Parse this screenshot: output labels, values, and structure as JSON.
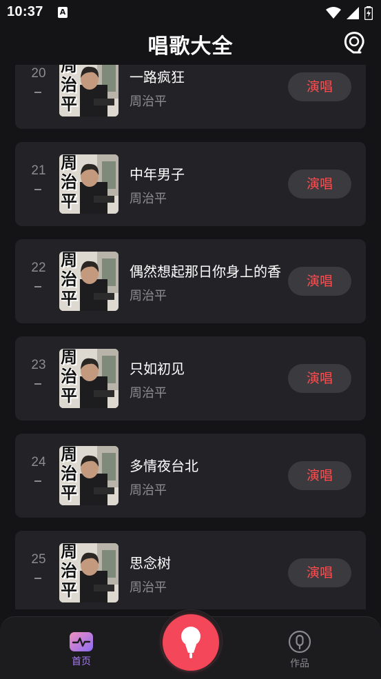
{
  "status_bar": {
    "time": "10:37",
    "app_icon_letter": "A"
  },
  "header": {
    "title": "唱歌大全"
  },
  "colors": {
    "accent_red": "#ff4d4f",
    "fab_red": "#f4475a",
    "nav_active_purple": "#a77cf3",
    "card_bg": "#232327",
    "page_bg": "#141417"
  },
  "cover_text": "周\n治\n平",
  "songs": [
    {
      "rank": "20",
      "title": "一路疯狂",
      "artist": "周治平",
      "button": "演唱"
    },
    {
      "rank": "21",
      "title": "中年男子",
      "artist": "周治平",
      "button": "演唱"
    },
    {
      "rank": "22",
      "title": "偶然想起那日你身上的香",
      "artist": "周治平",
      "button": "演唱"
    },
    {
      "rank": "23",
      "title": "只如初见",
      "artist": "周治平",
      "button": "演唱"
    },
    {
      "rank": "24",
      "title": "多情夜台北",
      "artist": "周治平",
      "button": "演唱"
    },
    {
      "rank": "25",
      "title": "思念树",
      "artist": "周治平",
      "button": "演唱"
    }
  ],
  "bottom_nav": {
    "home_label": "首页",
    "works_label": "作品",
    "home_icon": "pulse-icon",
    "works_icon": "mic-circle-icon",
    "center_icon": "microphone-icon"
  }
}
